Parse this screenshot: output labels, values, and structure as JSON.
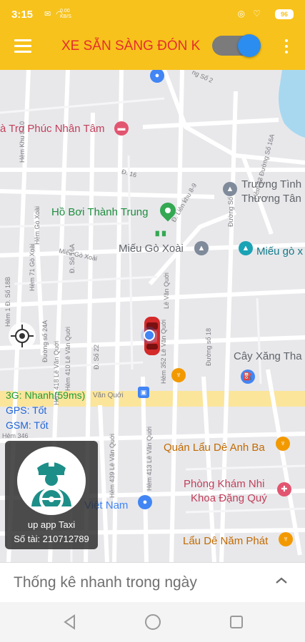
{
  "status_bar": {
    "time": "3:15",
    "icons_left": "✉ ◠",
    "network_speed_value": "0.00",
    "network_speed_unit": "KB/S",
    "icons_right": "◎ ♡",
    "battery": "96"
  },
  "header": {
    "title": "XE SẴN SÀNG ĐÓN KHÁCH",
    "toggle_on": true,
    "colors": {
      "background": "#f7c21b",
      "title": "#e52e2e",
      "toggle_thumb": "#2b8df0"
    }
  },
  "map": {
    "places": [
      {
        "id": "nha-tro",
        "name": "à Trọ Phúc Nhân Tâm"
      },
      {
        "id": "truong-tinh-1",
        "name": "Trường Tình"
      },
      {
        "id": "truong-tinh-2",
        "name": "Thương Tân"
      },
      {
        "id": "ho-boi",
        "name": "Hồ Bơi Thành Trung"
      },
      {
        "id": "mieu-go-xoai",
        "name": "Miếu Gò Xoài"
      },
      {
        "id": "mieu-go-x",
        "name": "Miếu gò x"
      },
      {
        "id": "cay-xang",
        "name": "Cây Xăng Tha"
      },
      {
        "id": "quan-lau",
        "name": "Quán Lẩu Dê Anh Ba"
      },
      {
        "id": "phong-kham-1",
        "name": "Phòng Khám Nhi"
      },
      {
        "id": "phong-kham-2",
        "name": "Khoa Đặng Quý"
      },
      {
        "id": "lau-de",
        "name": "Lẩu Dê Năm Phát"
      },
      {
        "id": "viet-nam",
        "name": "Việt Nam"
      }
    ],
    "streets": [
      "Hẻm Khu 2-10",
      "Đ. Liên khu 8-9",
      "Đường Số 20",
      "Hẻm 33 Đường Số 16A",
      "Đ. 16",
      "Đ. Số 16A",
      "Hẻm 71 Gò Xoài",
      "Hẻm Gò Xoài",
      "Miếu Gò Xoài",
      "Hẻm 1 Đ. Số 18B",
      "Đường số 24A",
      "Hẻm 418 Lê Văn Quới",
      "Hẻm 410 Lê Văn Quới",
      "Đ. Số 22",
      "Hẻm 352 Lê Văn Quới",
      "Lê Văn Quới",
      "Đường số 18",
      "Hẻm 439 Lê Văn Quới",
      "Hẻm 413 Lê Văn Quới",
      "Hẻm 346",
      "Văn Quới",
      "ng Số 2"
    ]
  },
  "connection": {
    "network": "3G: Nhanh(59ms)",
    "gps": "GPS: Tốt",
    "gsm": "GSM: Tốt"
  },
  "driver_card": {
    "app_name": "up app Taxi",
    "plate": "Số tài: 210712789"
  },
  "bottom_sheet": {
    "title": "Thống kê nhanh trong ngày"
  }
}
